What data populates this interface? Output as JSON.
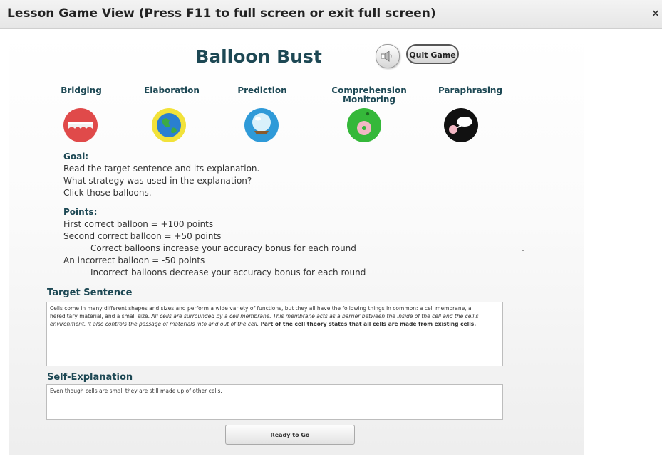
{
  "window": {
    "title": "Lesson Game View (Press F11 to full screen or exit full screen)",
    "close_label": "×"
  },
  "game": {
    "title": "Balloon Bust",
    "quit_label": "Quit Game",
    "sound_icon": "speaker-icon"
  },
  "strategies": [
    {
      "label": "Bridging",
      "icon": "bridge-balloon-icon",
      "color": "#e04a4a"
    },
    {
      "label": "Elaboration",
      "icon": "globe-balloon-icon",
      "color": "#f2e23a"
    },
    {
      "label": "Prediction",
      "icon": "crystal-ball-balloon-icon",
      "color": "#2f9ad8"
    },
    {
      "label": "Comprehension Monitoring",
      "icon": "brain-balloon-icon",
      "color": "#35b83a"
    },
    {
      "label": "Paraphrasing",
      "icon": "speech-bubble-balloon-icon",
      "color": "#111111"
    }
  ],
  "goal": {
    "heading": "Goal:",
    "lines": [
      "Read the target sentence and its explanation.",
      "What strategy was used in the explanation?",
      "Click those balloons."
    ]
  },
  "points": {
    "heading": "Points:",
    "line1": "First correct balloon = +100 points",
    "line2": "Second correct balloon = +50 points",
    "line3": "Correct balloons increase your accuracy bonus for each round",
    "line4": "An incorrect balloon = -50 points",
    "line5": "Incorrect balloons decrease your accuracy bonus for each round"
  },
  "target": {
    "label": "Target Sentence",
    "text_plain": "Cells come in many different shapes and sizes and perform a wide variety of functions, but they all have the following things in common: a cell membrane, a hereditary material, and a small size.",
    "text_italic": "All cells are surrounded by a cell membrane. This membrane acts as a barrier between the inside of the cell and the cell's environment. It also controls the passage of materials into and out of the cell.",
    "text_bold": "Part of the cell theory states that all cells are made from existing cells."
  },
  "self_explanation": {
    "label": "Self-Explanation",
    "text": "Even though cells are small they are still made up of other cells."
  },
  "ready_label": "Ready to Go"
}
